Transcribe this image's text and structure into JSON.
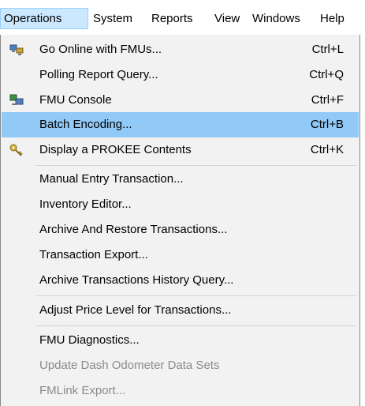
{
  "menubar": {
    "items": [
      {
        "label": "Operations"
      },
      {
        "label": "System"
      },
      {
        "label": "Reports"
      },
      {
        "label": "View"
      },
      {
        "label": "Windows"
      },
      {
        "label": "Help"
      }
    ]
  },
  "operations_menu": {
    "items": [
      {
        "label": "Go Online with FMUs...",
        "shortcut": "Ctrl+L",
        "icon": "network-computers-icon"
      },
      {
        "label": "Polling Report Query...",
        "shortcut": "Ctrl+Q"
      },
      {
        "label": "FMU Console",
        "shortcut": "Ctrl+F",
        "icon": "console-computers-icon"
      },
      {
        "label": "Batch Encoding...",
        "shortcut": "Ctrl+B",
        "highlighted": true
      },
      {
        "label": "Display a PROKEE Contents",
        "shortcut": "Ctrl+K",
        "icon": "key-icon"
      },
      {
        "label": "Manual Entry Transaction..."
      },
      {
        "label": "Inventory Editor..."
      },
      {
        "label": "Archive And Restore Transactions..."
      },
      {
        "label": "Transaction Export..."
      },
      {
        "label": "Archive Transactions History Query..."
      },
      {
        "label": "Adjust Price Level for Transactions..."
      },
      {
        "label": "FMU Diagnostics..."
      },
      {
        "label": "Update Dash Odometer Data Sets",
        "disabled": true
      },
      {
        "label": "FMLink Export...",
        "disabled": true
      }
    ]
  },
  "colors": {
    "menu_background": "#f2f2f2",
    "highlight": "#91c9f7",
    "active_menubar": "#cce8ff",
    "disabled_text": "#8a8a8a"
  }
}
